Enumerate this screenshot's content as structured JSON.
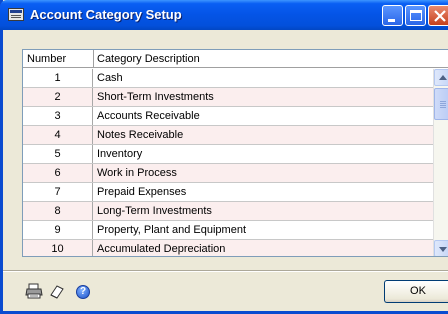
{
  "window": {
    "title": "Account Category Setup"
  },
  "grid": {
    "headers": {
      "number": "Number",
      "description": "Category Description"
    },
    "rows": [
      {
        "number": "1",
        "description": "Cash"
      },
      {
        "number": "2",
        "description": "Short-Term Investments"
      },
      {
        "number": "3",
        "description": "Accounts Receivable"
      },
      {
        "number": "4",
        "description": "Notes Receivable"
      },
      {
        "number": "5",
        "description": "Inventory"
      },
      {
        "number": "6",
        "description": "Work in Process"
      },
      {
        "number": "7",
        "description": "Prepaid Expenses"
      },
      {
        "number": "8",
        "description": "Long-Term Investments"
      },
      {
        "number": "9",
        "description": "Property, Plant and Equipment"
      },
      {
        "number": "10",
        "description": "Accumulated Depreciation"
      }
    ]
  },
  "footer": {
    "ok_label": "OK",
    "help_glyph": "?"
  },
  "colors": {
    "titlebar": "#0454e6",
    "window_bg": "#ece9d8",
    "alt_row": "#fbeeee",
    "close_button": "#c6401c"
  }
}
